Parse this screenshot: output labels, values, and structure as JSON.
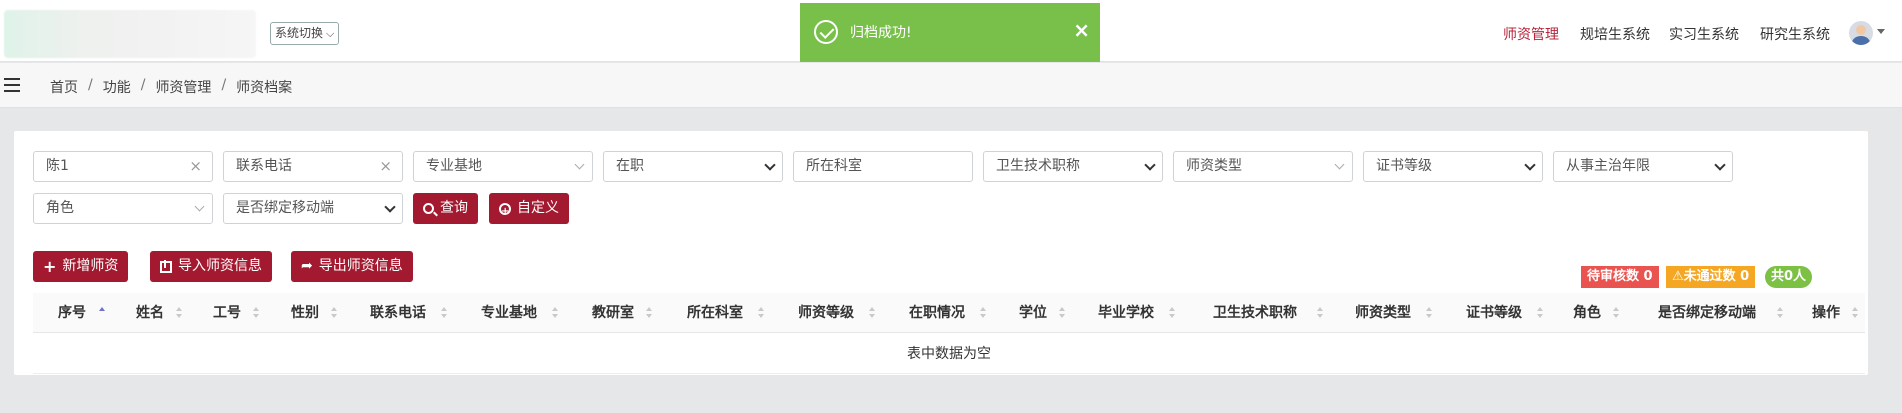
{
  "header": {
    "system_switch_label": "系统切换",
    "toast_message": "归档成功!",
    "toast_close": "×",
    "nav": [
      "师资管理",
      "规培生系统",
      "实习生系统",
      "研究生系统"
    ],
    "nav_active_color": "#b5243b"
  },
  "breadcrumb": [
    "首页",
    "功能",
    "师资管理",
    "师资档案"
  ],
  "breadcrumb_sep": "/",
  "filters": {
    "name_value": "陈1",
    "phone_placeholder": "联系电话",
    "base_placeholder": "专业基地",
    "status_selected": "在职",
    "dept_placeholder": "所在科室",
    "title_selected": "卫生技术职称",
    "teacher_type_placeholder": "师资类型",
    "cert_selected": "证书等级",
    "years_selected": "从事主治年限",
    "role_placeholder": "角色",
    "bind_selected": "是否绑定移动端",
    "clear_icon": "×"
  },
  "buttons": {
    "query": "查询",
    "custom": "自定义",
    "add": "新增师资",
    "import": "导入师资信息",
    "export": "导出师资信息"
  },
  "badges": {
    "pending": "待审核数 0",
    "failed": "未通过数 0",
    "total": "共0人",
    "warning_icon": "⚠"
  },
  "table": {
    "columns": [
      "序号",
      "姓名",
      "工号",
      "性别",
      "联系电话",
      "专业基地",
      "教研室",
      "所在科室",
      "师资等级",
      "在职情况",
      "学位",
      "毕业学校",
      "卫生技术职称",
      "师资类型",
      "证书等级",
      "角色",
      "是否绑定移动端",
      "操作"
    ],
    "empty_text": "表中数据为空"
  },
  "colors": {
    "primary": "#a31a30",
    "toast": "#79c04b",
    "badge_red": "#e95450",
    "badge_orange": "#f5a623",
    "badge_green": "#7cc044"
  }
}
